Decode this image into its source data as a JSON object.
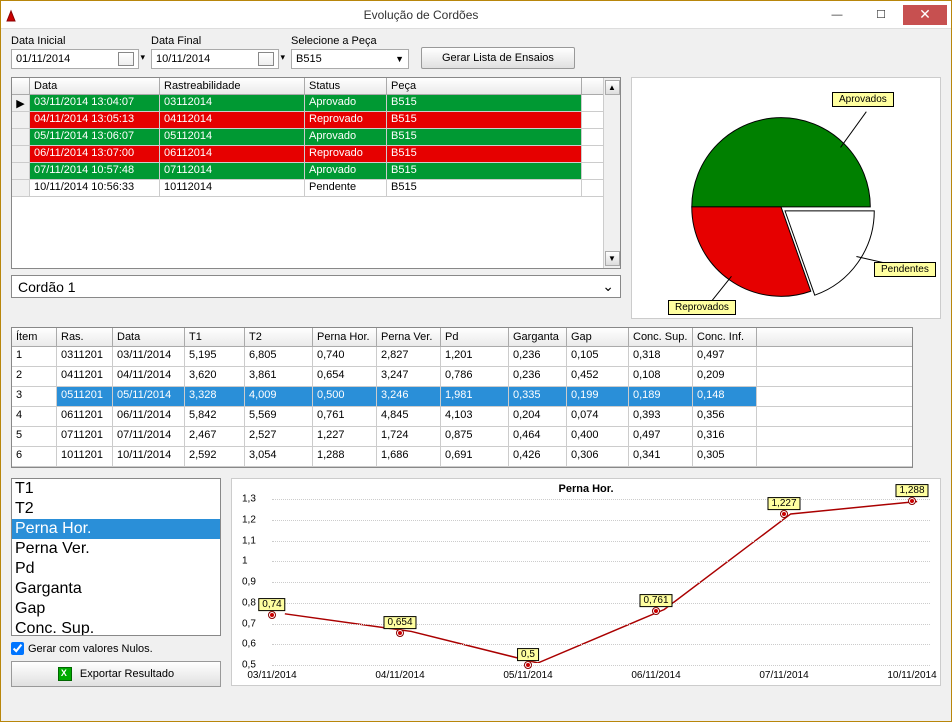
{
  "window": {
    "title": "Evolução de Cordões"
  },
  "filters": {
    "data_inicial_label": "Data Inicial",
    "data_inicial_value": "01/11/2014",
    "data_final_label": "Data Final",
    "data_final_value": "10/11/2014",
    "peca_label": "Selecione a Peça",
    "peca_value": "B515",
    "gerar_btn": "Gerar Lista de Ensaios"
  },
  "grid1": {
    "headers": {
      "data": "Data",
      "ras": "Rastreabilidade",
      "status": "Status",
      "peca": "Peça"
    },
    "rows": [
      {
        "marker": "▶",
        "data": "03/11/2014 13:04:07",
        "ras": "03112014",
        "status": "Aprovado",
        "peca": "B515",
        "cls": "st-green"
      },
      {
        "marker": "",
        "data": "04/11/2014 13:05:13",
        "ras": "04112014",
        "status": "Reprovado",
        "peca": "B515",
        "cls": "st-red"
      },
      {
        "marker": "",
        "data": "05/11/2014 13:06:07",
        "ras": "05112014",
        "status": "Aprovado",
        "peca": "B515",
        "cls": "st-green"
      },
      {
        "marker": "",
        "data": "06/11/2014 13:07:00",
        "ras": "06112014",
        "status": "Reprovado",
        "peca": "B515",
        "cls": "st-red"
      },
      {
        "marker": "",
        "data": "07/11/2014 10:57:48",
        "ras": "07112014",
        "status": "Aprovado",
        "peca": "B515",
        "cls": "st-green"
      },
      {
        "marker": "",
        "data": "10/11/2014 10:56:33",
        "ras": "10112014",
        "status": "Pendente",
        "peca": "B515",
        "cls": "st-white"
      }
    ]
  },
  "cordao_select": "Cordão 1",
  "pie": {
    "labels": {
      "aprovados": "Aprovados",
      "reprovados": "Reprovados",
      "pendentes": "Pendentes"
    }
  },
  "grid2": {
    "headers": [
      "Ítem",
      "Ras.",
      "Data",
      "T1",
      "T2",
      "Perna Hor.",
      "Perna Ver.",
      "Pd",
      "Garganta",
      "Gap",
      "Conc. Sup.",
      "Conc. Inf."
    ],
    "rows": [
      [
        "1",
        "0311201",
        "03/11/2014",
        "5,195",
        "6,805",
        "0,740",
        "2,827",
        "1,201",
        "0,236",
        "0,105",
        "0,318",
        "0,497"
      ],
      [
        "2",
        "0411201",
        "04/11/2014",
        "3,620",
        "3,861",
        "0,654",
        "3,247",
        "0,786",
        "0,236",
        "0,452",
        "0,108",
        "0,209"
      ],
      [
        "3",
        "0511201",
        "05/11/2014",
        "3,328",
        "4,009",
        "0,500",
        "3,246",
        "1,981",
        "0,335",
        "0,199",
        "0,189",
        "0,148"
      ],
      [
        "4",
        "0611201",
        "06/11/2014",
        "5,842",
        "5,569",
        "0,761",
        "4,845",
        "4,103",
        "0,204",
        "0,074",
        "0,393",
        "0,356"
      ],
      [
        "5",
        "0711201",
        "07/11/2014",
        "2,467",
        "2,527",
        "1,227",
        "1,724",
        "0,875",
        "0,464",
        "0,400",
        "0,497",
        "0,316"
      ],
      [
        "6",
        "1011201",
        "10/11/2014",
        "2,592",
        "3,054",
        "1,288",
        "1,686",
        "0,691",
        "0,426",
        "0,306",
        "0,341",
        "0,305"
      ]
    ],
    "selected_index": 2
  },
  "listbox": {
    "items": [
      "T1",
      "T2",
      "Perna Hor.",
      "Perna Ver.",
      "Pd",
      "Garganta",
      "Gap",
      "Conc. Sup."
    ],
    "selected_index": 2
  },
  "checkbox_label": "Gerar com valores Nulos.",
  "export_btn": "Exportar Resultado",
  "chart_data": {
    "type": "line",
    "title": "Perna Hor.",
    "categories": [
      "03/11/2014",
      "04/11/2014",
      "05/11/2014",
      "06/11/2014",
      "07/11/2014",
      "10/11/2014"
    ],
    "values": [
      0.74,
      0.654,
      0.5,
      0.761,
      1.227,
      1.288
    ],
    "labels": [
      "0,74",
      "0,654",
      "0,5",
      "0,761",
      "1,227",
      "1,288"
    ],
    "ylim": [
      0.5,
      1.3
    ],
    "yticks": [
      "0,5",
      "0,6",
      "0,7",
      "0,8",
      "0,9",
      "1",
      "1,1",
      "1,2",
      "1,3"
    ]
  }
}
